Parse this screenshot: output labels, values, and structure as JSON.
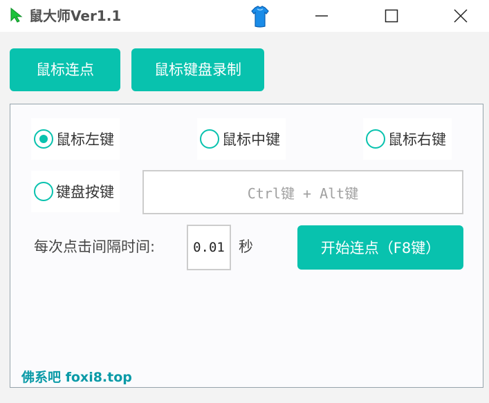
{
  "window": {
    "title": "鼠大师Ver1.1",
    "accent_color": "#08c2ae"
  },
  "titlebar": {
    "icons": [
      "cursor-arrow-icon",
      "shirt-icon",
      "minimize-icon",
      "maximize-icon",
      "close-icon"
    ]
  },
  "tabs": [
    {
      "label": "鼠标连点"
    },
    {
      "label": "鼠标键盘录制"
    }
  ],
  "panel": {
    "radios": [
      {
        "label": "鼠标左键",
        "selected": true
      },
      {
        "label": "鼠标中键",
        "selected": false
      },
      {
        "label": "鼠标右键",
        "selected": false
      },
      {
        "label": "键盘按键",
        "selected": false
      }
    ],
    "hotkey_value": "Ctrl键 + Alt键",
    "interval_label": "每次点击间隔时间:",
    "interval_value": "0.01",
    "interval_unit": "秒",
    "start_button": "开始连点（F8键）"
  },
  "footer": {
    "link_text": "佛系吧  foxi8.top"
  }
}
